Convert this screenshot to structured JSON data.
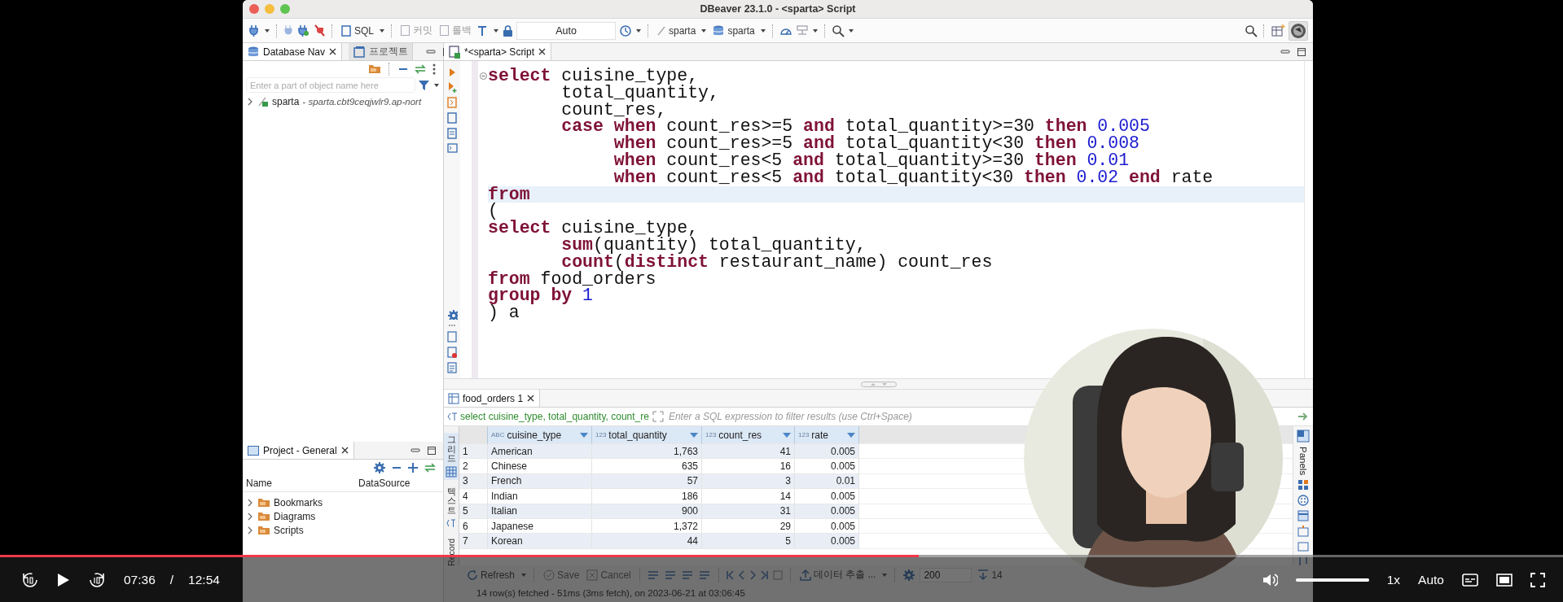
{
  "window": {
    "title": "DBeaver 23.1.0 - <sparta> Script"
  },
  "toolbar": {
    "sql": "SQL",
    "commit": {
      "label": "커밋",
      "disabled": true
    },
    "rollback": {
      "label": "롤백",
      "disabled": true
    },
    "transaction_mode": "Auto",
    "connection": "sparta",
    "schema": "sparta"
  },
  "navigator": {
    "tabs": [
      {
        "label": "Database Nav",
        "selected": true,
        "closable": true
      },
      {
        "label": "프로젝트",
        "selected": false,
        "closable": false
      }
    ],
    "filter_placeholder": "Enter a part of object name here",
    "tree": [
      {
        "label": "sparta",
        "detail": "- sparta.cbt9ceqjwlr9.ap-nort",
        "expanded": false
      }
    ]
  },
  "project_panel": {
    "tab": "Project - General",
    "columns": [
      "Name",
      "DataSource"
    ],
    "items": [
      {
        "label": "Bookmarks",
        "expanded": false
      },
      {
        "label": "Diagrams",
        "expanded": false
      },
      {
        "label": "Scripts",
        "expanded": false
      }
    ]
  },
  "editor": {
    "tab": "*<sparta> Script",
    "lines": [
      {
        "current": false,
        "fold": true,
        "tokens": [
          {
            "kind": "kw",
            "text": "select"
          },
          {
            "kind": "plain",
            "text": " cuisine_type,"
          }
        ]
      },
      {
        "current": false,
        "fold": false,
        "tokens": [
          {
            "kind": "plain",
            "text": "       total_quantity,"
          }
        ]
      },
      {
        "current": false,
        "fold": false,
        "tokens": [
          {
            "kind": "plain",
            "text": "       count_res,"
          }
        ]
      },
      {
        "current": false,
        "fold": false,
        "tokens": [
          {
            "kind": "kw",
            "text": "       case when"
          },
          {
            "kind": "plain",
            "text": " count_res>=5 "
          },
          {
            "kind": "kw",
            "text": "and"
          },
          {
            "kind": "plain",
            "text": " total_quantity>=30 "
          },
          {
            "kind": "kw",
            "text": "then"
          },
          {
            "kind": "num",
            "text": " 0.005"
          }
        ]
      },
      {
        "current": false,
        "fold": false,
        "tokens": [
          {
            "kind": "kw",
            "text": "            when"
          },
          {
            "kind": "plain",
            "text": " count_res>=5 "
          },
          {
            "kind": "kw",
            "text": "and"
          },
          {
            "kind": "plain",
            "text": " total_quantity<30 "
          },
          {
            "kind": "kw",
            "text": "then"
          },
          {
            "kind": "num",
            "text": " 0.008"
          }
        ]
      },
      {
        "current": false,
        "fold": false,
        "tokens": [
          {
            "kind": "kw",
            "text": "            when"
          },
          {
            "kind": "plain",
            "text": " count_res<5 "
          },
          {
            "kind": "kw",
            "text": "and"
          },
          {
            "kind": "plain",
            "text": " total_quantity>=30 "
          },
          {
            "kind": "kw",
            "text": "then"
          },
          {
            "kind": "num",
            "text": " 0.01"
          }
        ]
      },
      {
        "current": false,
        "fold": false,
        "tokens": [
          {
            "kind": "kw",
            "text": "            when"
          },
          {
            "kind": "plain",
            "text": " count_res<5 "
          },
          {
            "kind": "kw",
            "text": "and"
          },
          {
            "kind": "plain",
            "text": " total_quantity<30 "
          },
          {
            "kind": "kw",
            "text": "then"
          },
          {
            "kind": "num",
            "text": " 0.02"
          },
          {
            "kind": "kw",
            "text": " end"
          },
          {
            "kind": "plain",
            "text": " rate"
          }
        ]
      },
      {
        "current": true,
        "fold": false,
        "tokens": [
          {
            "kind": "kw",
            "text": "from"
          }
        ]
      },
      {
        "current": false,
        "fold": false,
        "tokens": [
          {
            "kind": "plain",
            "text": "("
          }
        ]
      },
      {
        "current": false,
        "fold": false,
        "tokens": [
          {
            "kind": "kw",
            "text": "select"
          },
          {
            "kind": "plain",
            "text": " cuisine_type,"
          }
        ]
      },
      {
        "current": false,
        "fold": false,
        "tokens": [
          {
            "kind": "kw",
            "text": "       sum"
          },
          {
            "kind": "plain",
            "text": "(quantity) total_quantity,"
          }
        ]
      },
      {
        "current": false,
        "fold": false,
        "tokens": [
          {
            "kind": "kw",
            "text": "       count"
          },
          {
            "kind": "plain",
            "text": "("
          },
          {
            "kind": "kw",
            "text": "distinct"
          },
          {
            "kind": "plain",
            "text": " restaurant_name) count_res"
          }
        ]
      },
      {
        "current": false,
        "fold": false,
        "tokens": [
          {
            "kind": "kw",
            "text": "from"
          },
          {
            "kind": "plain",
            "text": " food_orders"
          }
        ]
      },
      {
        "current": false,
        "fold": false,
        "tokens": [
          {
            "kind": "kw",
            "text": "group by"
          },
          {
            "kind": "num",
            "text": " 1"
          }
        ]
      },
      {
        "current": false,
        "fold": false,
        "tokens": [
          {
            "kind": "plain",
            "text": ") a"
          }
        ]
      }
    ]
  },
  "results": {
    "tab": "food_orders 1",
    "query": "select cuisine_type, total_quantity, count_re",
    "filter_placeholder": "Enter a SQL expression to filter results (use Ctrl+Space)",
    "side_tabs": [
      {
        "label": "그리드",
        "selected": true
      },
      {
        "label": "텍스트",
        "selected": false
      },
      {
        "label": "Record",
        "selected": false
      }
    ],
    "columns": [
      {
        "type_label": "ABC",
        "name": "cuisine_type",
        "kind": "text"
      },
      {
        "type_label": "123",
        "name": "total_quantity",
        "kind": "number"
      },
      {
        "type_label": "123",
        "name": "count_res",
        "kind": "number"
      },
      {
        "type_label": "123",
        "name": "rate",
        "kind": "number"
      }
    ],
    "rows": [
      {
        "index": "1",
        "cells": [
          "American",
          "1,763",
          "41",
          "0.005"
        ]
      },
      {
        "index": "2",
        "cells": [
          "Chinese",
          "635",
          "16",
          "0.005"
        ]
      },
      {
        "index": "3",
        "cells": [
          "French",
          "57",
          "3",
          "0.01"
        ]
      },
      {
        "index": "4",
        "cells": [
          "Indian",
          "186",
          "14",
          "0.005"
        ]
      },
      {
        "index": "5",
        "cells": [
          "Italian",
          "900",
          "31",
          "0.005"
        ]
      },
      {
        "index": "6",
        "cells": [
          "Japanese",
          "1,372",
          "29",
          "0.005"
        ]
      },
      {
        "index": "7",
        "cells": [
          "Korean",
          "44",
          "5",
          "0.005"
        ]
      }
    ],
    "panels_label": "Panels",
    "bottom_toolbar": {
      "refresh": "Refresh",
      "save": {
        "label": "Save",
        "disabled": true
      },
      "cancel": {
        "label": "Cancel",
        "disabled": true
      },
      "export": "데이터 추출 ...",
      "fetch_size": "200",
      "row_count": "14"
    },
    "status": "14 row(s) fetched - 51ms (3ms fetch), on 2023-06-21 at 03:06:45"
  },
  "player": {
    "progress": {
      "level": 0.588
    },
    "current_time": "07:36",
    "separator": "/",
    "duration": "12:54",
    "playing": false,
    "volume": {
      "level": 1
    },
    "speed": "1x",
    "quality": "Auto"
  }
}
